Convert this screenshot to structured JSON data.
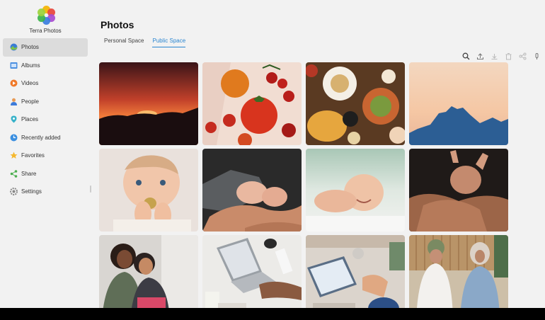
{
  "app": {
    "name": "Terra Photos"
  },
  "sidebar": {
    "items": [
      {
        "label": "Photos",
        "icon": "photos-icon"
      },
      {
        "label": "Albums",
        "icon": "albums-icon"
      },
      {
        "label": "Videos",
        "icon": "videos-icon"
      },
      {
        "label": "People",
        "icon": "people-icon"
      },
      {
        "label": "Places",
        "icon": "places-icon"
      },
      {
        "label": "Recently added",
        "icon": "recently-added-icon"
      },
      {
        "label": "Favorites",
        "icon": "favorites-icon"
      },
      {
        "label": "Share",
        "icon": "share-icon"
      },
      {
        "label": "Settings",
        "icon": "settings-icon"
      }
    ],
    "active": "Photos"
  },
  "main": {
    "title": "Photos",
    "tabs": [
      {
        "label": "Personal Space"
      },
      {
        "label": "Public Space"
      }
    ],
    "active_tab": "Public Space",
    "toolbar": [
      "search-icon",
      "upload-icon",
      "download-icon",
      "delete-icon",
      "share-icon",
      "more-icon"
    ],
    "photos": [
      {
        "subject": "sunset-over-mountains"
      },
      {
        "subject": "tomatoes"
      },
      {
        "subject": "food-spread"
      },
      {
        "subject": "blue-mountains-dusk"
      },
      {
        "subject": "baby-eating"
      },
      {
        "subject": "baby-feet-in-hands"
      },
      {
        "subject": "smiling-baby"
      },
      {
        "subject": "hands-holding-baby"
      },
      {
        "subject": "women-talking"
      },
      {
        "subject": "laptop-desk"
      },
      {
        "subject": "tablet-working"
      },
      {
        "subject": "women-sitting"
      }
    ]
  },
  "colors": {
    "accent": "#2b86d1",
    "background": "#f2f2f2",
    "sidebar_active": "#dcdcdc"
  }
}
